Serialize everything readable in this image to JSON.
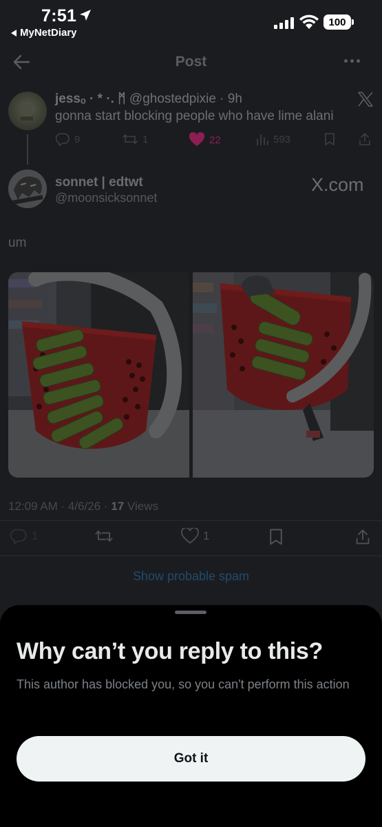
{
  "status_bar": {
    "time": "7:51",
    "back_app": "MyNetDiary",
    "battery": "100"
  },
  "header": {
    "title": "Post"
  },
  "parent_tweet": {
    "display_name": "jessₒ · * ·. ᛗ",
    "handle": "@ghostedpixie",
    "time": "9h",
    "text": "gonna start blocking people who have lime alani",
    "replies": "9",
    "retweets": "1",
    "likes": "22",
    "views": "593",
    "like_color": "#8b1f54"
  },
  "main_tweet": {
    "display_name": "sonnet | edtwt",
    "handle": "@moonsicksonnet",
    "source_label": "X.com",
    "text": "um",
    "timestamp": "12:09 AM · 4/6/26 · ",
    "views_count": "17",
    "views_label": " Views",
    "replies": "1",
    "likes": "1"
  },
  "spam_link": "Show probable spam",
  "sheet": {
    "title": "Why can’t you reply to this?",
    "body": "This author has blocked you, so you can't perform this action",
    "button": "Got it"
  },
  "colors": {
    "background": "#1b1c1f",
    "sheet": "#000000",
    "button": "#eff3f4",
    "link": "#1f4c6d"
  }
}
